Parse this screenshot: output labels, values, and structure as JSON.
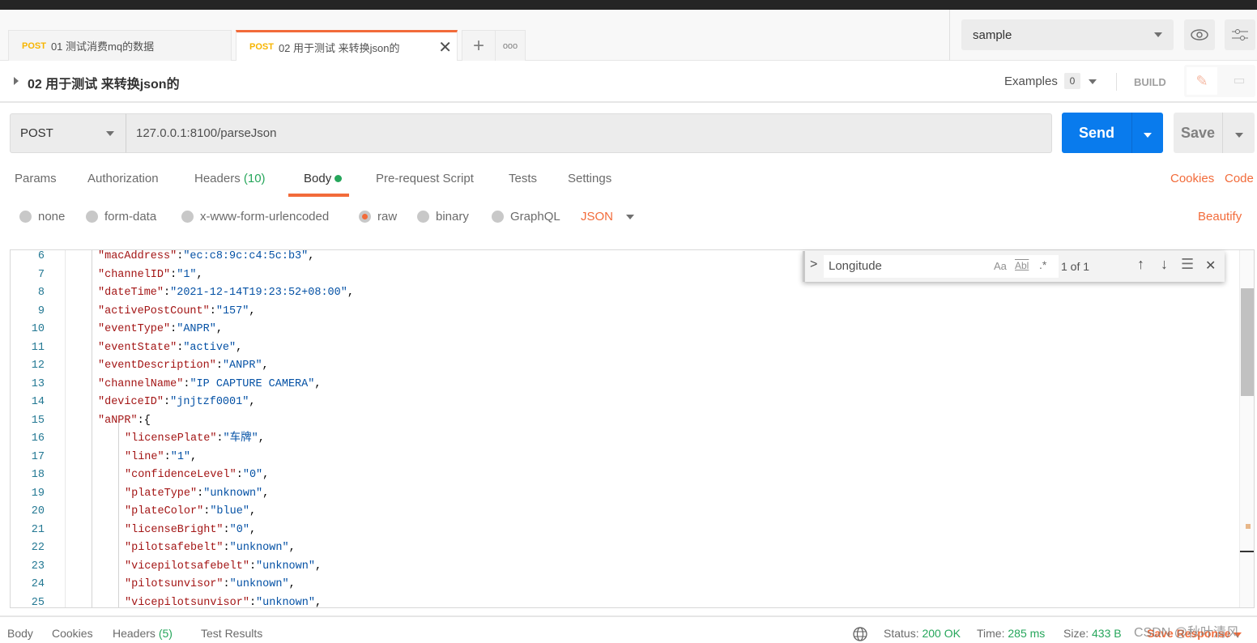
{
  "tabs": [
    {
      "method": "POST",
      "title": "01 测试消费mq的数据",
      "active": false
    },
    {
      "method": "POST",
      "title": "02 用于测试 来转换json的",
      "active": true
    }
  ],
  "environment": {
    "selected": "sample"
  },
  "request": {
    "title": "02 用于测试 来转换json的",
    "examples_label": "Examples",
    "examples_count": "0",
    "build_label": "BUILD",
    "method": "POST",
    "url": "127.0.0.1:8100/parseJson",
    "send_label": "Send",
    "save_label": "Save"
  },
  "subtabs": {
    "params": "Params",
    "authorization": "Authorization",
    "headers": "Headers",
    "headers_count": "(10)",
    "body": "Body",
    "prerequest": "Pre-request Script",
    "tests": "Tests",
    "settings": "Settings",
    "cookies": "Cookies",
    "code": "Code"
  },
  "body_modes": {
    "none": "none",
    "form_data": "form-data",
    "urlencoded": "x-www-form-urlencoded",
    "raw": "raw",
    "binary": "binary",
    "graphql": "GraphQL",
    "format": "JSON",
    "beautify": "Beautify",
    "selected": "raw"
  },
  "find": {
    "query": "Longitude",
    "match_case": "Aa",
    "whole_word": "Abl",
    "regex": ".*",
    "result": "1 of 1"
  },
  "code_lines": [
    {
      "n": "6",
      "indent": 1,
      "key": "\"macAddress\"",
      "value": "\"ec:c8:9c:c4:5c:b3\"",
      "tail": ","
    },
    {
      "n": "7",
      "indent": 1,
      "key": "\"channelID\"",
      "value": "\"1\"",
      "tail": ","
    },
    {
      "n": "8",
      "indent": 1,
      "key": "\"dateTime\"",
      "value": "\"2021-12-14T19:23:52+08:00\"",
      "tail": ","
    },
    {
      "n": "9",
      "indent": 1,
      "key": "\"activePostCount\"",
      "value": "\"157\"",
      "tail": ","
    },
    {
      "n": "10",
      "indent": 1,
      "key": "\"eventType\"",
      "value": "\"ANPR\"",
      "tail": ","
    },
    {
      "n": "11",
      "indent": 1,
      "key": "\"eventState\"",
      "value": "\"active\"",
      "tail": ","
    },
    {
      "n": "12",
      "indent": 1,
      "key": "\"eventDescription\"",
      "value": "\"ANPR\"",
      "tail": ","
    },
    {
      "n": "13",
      "indent": 1,
      "key": "\"channelName\"",
      "value": "\"IP CAPTURE CAMERA\"",
      "tail": ","
    },
    {
      "n": "14",
      "indent": 1,
      "key": "\"deviceID\"",
      "value": "\"jnjtzf0001\"",
      "tail": ","
    },
    {
      "n": "15",
      "indent": 1,
      "key": "\"aNPR\"",
      "value": "",
      "tail": "{"
    },
    {
      "n": "16",
      "indent": 2,
      "key": "\"licensePlate\"",
      "value": "\"车牌\"",
      "tail": ","
    },
    {
      "n": "17",
      "indent": 2,
      "key": "\"line\"",
      "value": "\"1\"",
      "tail": ","
    },
    {
      "n": "18",
      "indent": 2,
      "key": "\"confidenceLevel\"",
      "value": "\"0\"",
      "tail": ","
    },
    {
      "n": "19",
      "indent": 2,
      "key": "\"plateType\"",
      "value": "\"unknown\"",
      "tail": ","
    },
    {
      "n": "20",
      "indent": 2,
      "key": "\"plateColor\"",
      "value": "\"blue\"",
      "tail": ","
    },
    {
      "n": "21",
      "indent": 2,
      "key": "\"licenseBright\"",
      "value": "\"0\"",
      "tail": ","
    },
    {
      "n": "22",
      "indent": 2,
      "key": "\"pilotsafebelt\"",
      "value": "\"unknown\"",
      "tail": ","
    },
    {
      "n": "23",
      "indent": 2,
      "key": "\"vicepilotsafebelt\"",
      "value": "\"unknown\"",
      "tail": ","
    },
    {
      "n": "24",
      "indent": 2,
      "key": "\"pilotsunvisor\"",
      "value": "\"unknown\"",
      "tail": ","
    },
    {
      "n": "25",
      "indent": 2,
      "key": "\"vicepilotsunvisor\"",
      "value": "\"unknown\"",
      "tail": ","
    }
  ],
  "response": {
    "body": "Body",
    "cookies": "Cookies",
    "headers": "Headers",
    "headers_count": "(5)",
    "test_results": "Test Results",
    "status_label": "Status:",
    "status": "200 OK",
    "time_label": "Time:",
    "time": "285 ms",
    "size_label": "Size:",
    "size": "433 B",
    "save_response": "Save Response"
  },
  "watermark": "CSDN @秋叶清风",
  "colors": {
    "accent": "#f26b3a",
    "send": "#097bed",
    "success": "#26a65b",
    "post": "#f7b500"
  }
}
